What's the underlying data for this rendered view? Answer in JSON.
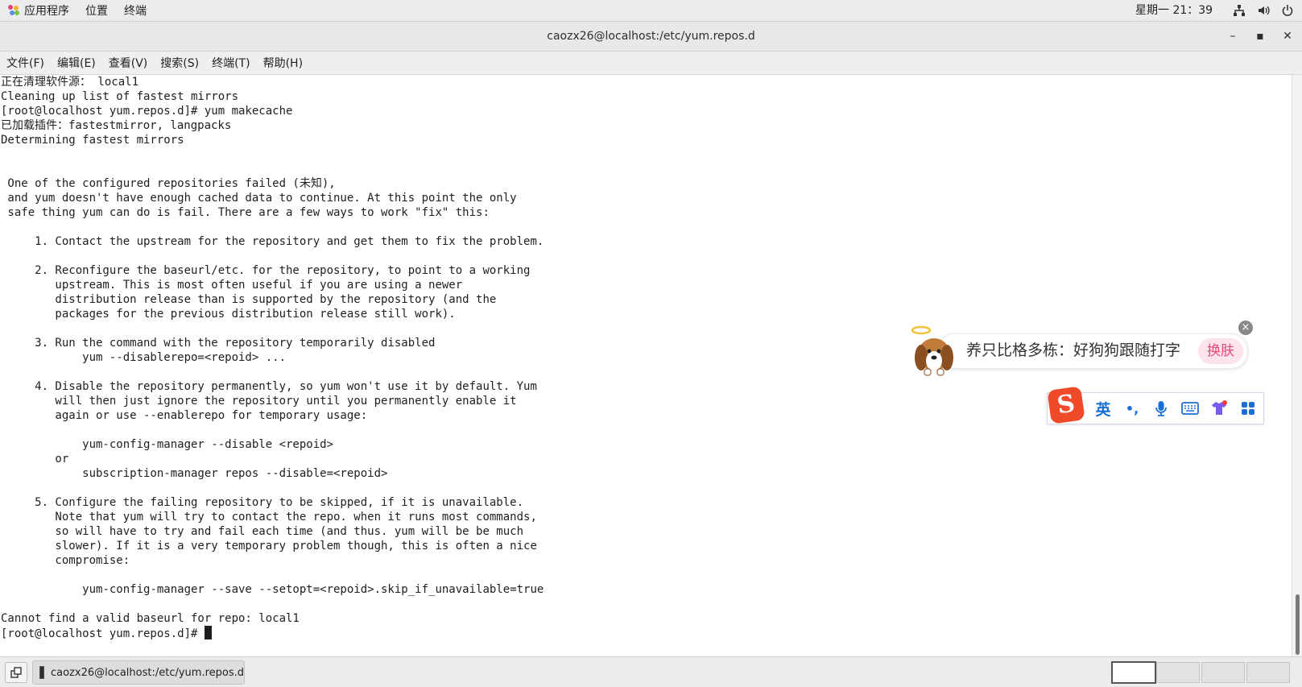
{
  "topbar": {
    "menus": [
      "应用程序",
      "位置",
      "终端"
    ],
    "clock": "星期一 21：39"
  },
  "window": {
    "title": "caozx26@localhost:/etc/yum.repos.d",
    "minimize": "–",
    "maximize": "▪",
    "close": "✕"
  },
  "menubar": [
    "文件(F)",
    "编辑(E)",
    "查看(V)",
    "搜索(S)",
    "终端(T)",
    "帮助(H)"
  ],
  "terminal": {
    "lines": [
      "正在清理软件源： local1",
      "Cleaning up list of fastest mirrors",
      "[root@localhost yum.repos.d]# yum makecache",
      "已加载插件：fastestmirror, langpacks",
      "Determining fastest mirrors",
      "",
      "",
      " One of the configured repositories failed (未知),",
      " and yum doesn't have enough cached data to continue. At this point the only",
      " safe thing yum can do is fail. There are a few ways to work \"fix\" this:",
      "",
      "     1. Contact the upstream for the repository and get them to fix the problem.",
      "",
      "     2. Reconfigure the baseurl/etc. for the repository, to point to a working",
      "        upstream. This is most often useful if you are using a newer",
      "        distribution release than is supported by the repository (and the",
      "        packages for the previous distribution release still work).",
      "",
      "     3. Run the command with the repository temporarily disabled",
      "            yum --disablerepo=<repoid> ...",
      "",
      "     4. Disable the repository permanently, so yum won't use it by default. Yum",
      "        will then just ignore the repository until you permanently enable it",
      "        again or use --enablerepo for temporary usage:",
      "",
      "            yum-config-manager --disable <repoid>",
      "        or",
      "            subscription-manager repos --disable=<repoid>",
      "",
      "     5. Configure the failing repository to be skipped, if it is unavailable.",
      "        Note that yum will try to contact the repo. when it runs most commands,",
      "        so will have to try and fail each time (and thus. yum will be be much",
      "        slower). If it is a very temporary problem though, this is often a nice",
      "        compromise:",
      "",
      "            yum-config-manager --save --setopt=<repoid>.skip_if_unavailable=true",
      "",
      "Cannot find a valid baseurl for repo: local1"
    ],
    "prompt": "[root@localhost yum.repos.d]# "
  },
  "ad": {
    "text": "养只比格多栋：好狗狗跟随打字",
    "button": "换肤",
    "close": "×"
  },
  "ime": {
    "logo": "S",
    "mode": "英",
    "punct": "•,",
    "icons": [
      "microphone-icon",
      "keyboard-icon",
      "shirt-icon",
      "grid-icon"
    ]
  },
  "taskbar": {
    "task_title": "caozx26@localhost:/etc/yum.repos.d"
  },
  "colors": {
    "ime_blue": "#1a6fd6",
    "ime_logo": "#ef4a2a",
    "skin_pink": "#e64a7a"
  }
}
